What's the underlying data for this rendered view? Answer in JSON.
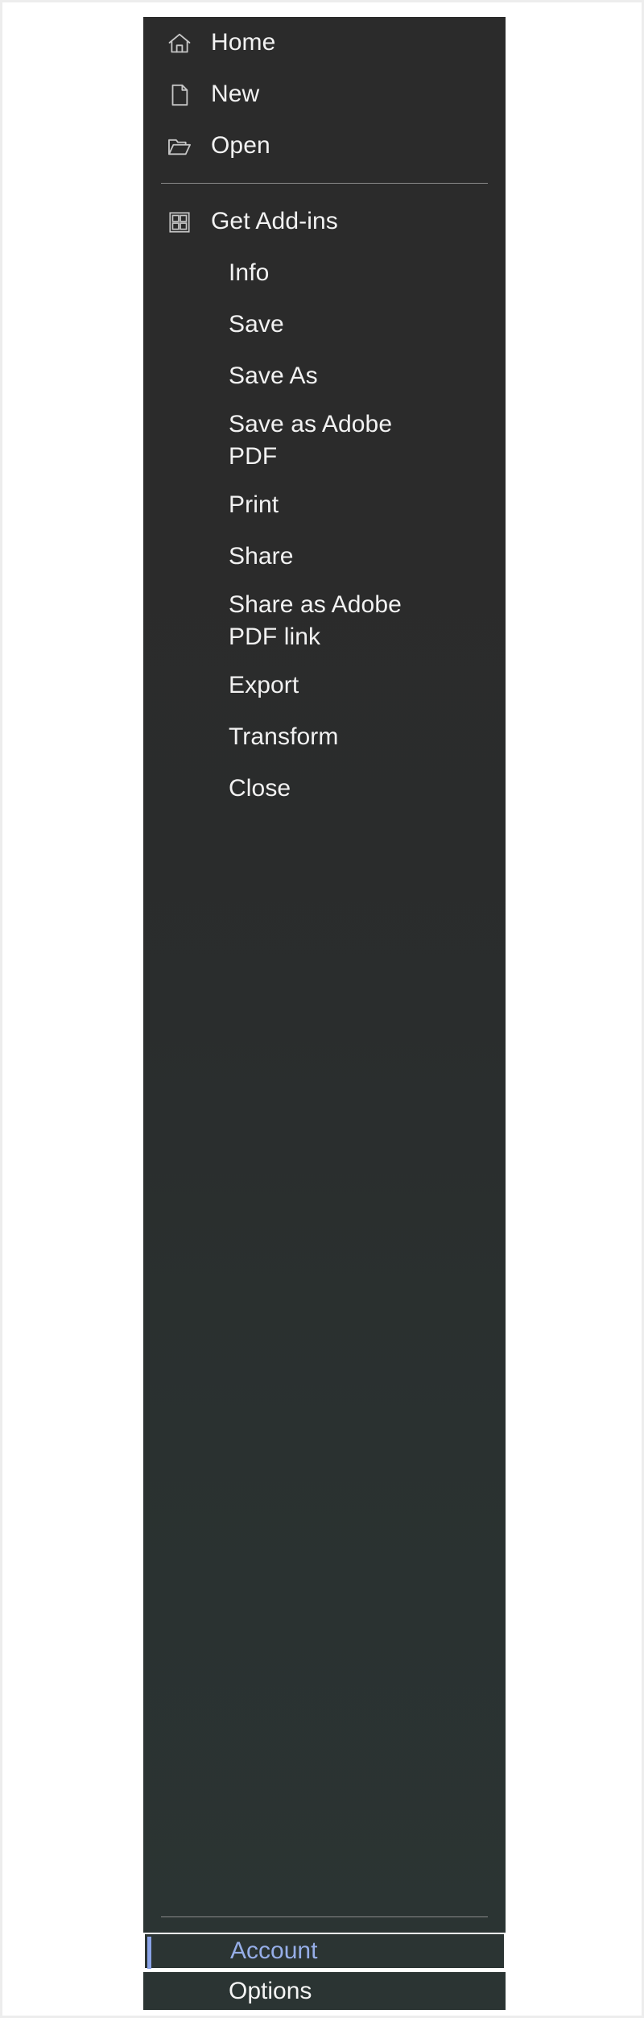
{
  "app": {
    "surface": "office-backstage-file-menu",
    "panel_bg_top": "#2B2B2B",
    "panel_bg_bottom": "#2B3433",
    "text_color": "#F2F2F2",
    "divider_color": "#8A8A8A",
    "accent_color": "#8BA4E8",
    "selected_text_color": "#96AEE8",
    "page_bg": "#FFFFFF"
  },
  "nav": {
    "top_group": [
      {
        "id": "home",
        "label": "Home",
        "icon": "home-icon"
      },
      {
        "id": "new",
        "label": "New",
        "icon": "new-document-icon"
      },
      {
        "id": "open",
        "label": "Open",
        "icon": "open-folder-icon"
      }
    ],
    "main_group": [
      {
        "id": "get-add-ins",
        "label": "Get Add-ins",
        "icon": "add-ins-grid-icon"
      },
      {
        "id": "info",
        "label": "Info",
        "icon": null
      },
      {
        "id": "save",
        "label": "Save",
        "icon": null
      },
      {
        "id": "save-as",
        "label": "Save As",
        "icon": null
      },
      {
        "id": "save-as-adobe-pdf",
        "label": "Save as Adobe\nPDF",
        "icon": null
      },
      {
        "id": "print",
        "label": "Print",
        "icon": null
      },
      {
        "id": "share",
        "label": "Share",
        "icon": null
      },
      {
        "id": "share-as-adobe-pdf",
        "label": "Share as Adobe\nPDF link",
        "icon": null
      },
      {
        "id": "export",
        "label": "Export",
        "icon": null
      },
      {
        "id": "transform",
        "label": "Transform",
        "icon": null
      },
      {
        "id": "close",
        "label": "Close",
        "icon": null
      }
    ],
    "bottom_group": [
      {
        "id": "account",
        "label": "Account",
        "selected": true
      },
      {
        "id": "options",
        "label": "Options",
        "selected": false
      }
    ]
  }
}
